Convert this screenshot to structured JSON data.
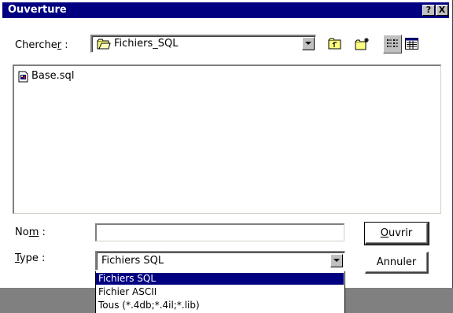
{
  "window": {
    "title": "Ouverture",
    "help_label": "?",
    "close_label": "X"
  },
  "look_in": {
    "label_pre": "Cherche",
    "label_accel": "r",
    "label_post": " :",
    "value": "Fichiers_SQL"
  },
  "toolbar": {
    "up_folder_icon": "folder-up-icon",
    "new_folder_icon": "new-folder-icon",
    "list_view_icon": "list-view-icon",
    "details_view_icon": "details-view-icon"
  },
  "files": [
    {
      "name": "Base.sql",
      "icon": "sql-file-icon"
    }
  ],
  "filename": {
    "label_pre": "No",
    "label_accel": "m",
    "label_post": " :",
    "value": ""
  },
  "filetype": {
    "label_accel": "T",
    "label_post": "ype :",
    "value": "Fichiers SQL",
    "options": [
      "Fichiers SQL",
      "Fichier ASCII",
      "Tous (*.4db;*.4il;*.lib)"
    ],
    "selected_index": 0
  },
  "buttons": {
    "open_accel": "O",
    "open_rest": "uvrir",
    "cancel_label": "Annuler"
  },
  "colors": {
    "title_bar": "#000080",
    "selection": "#000080",
    "backdrop": "#808080"
  }
}
